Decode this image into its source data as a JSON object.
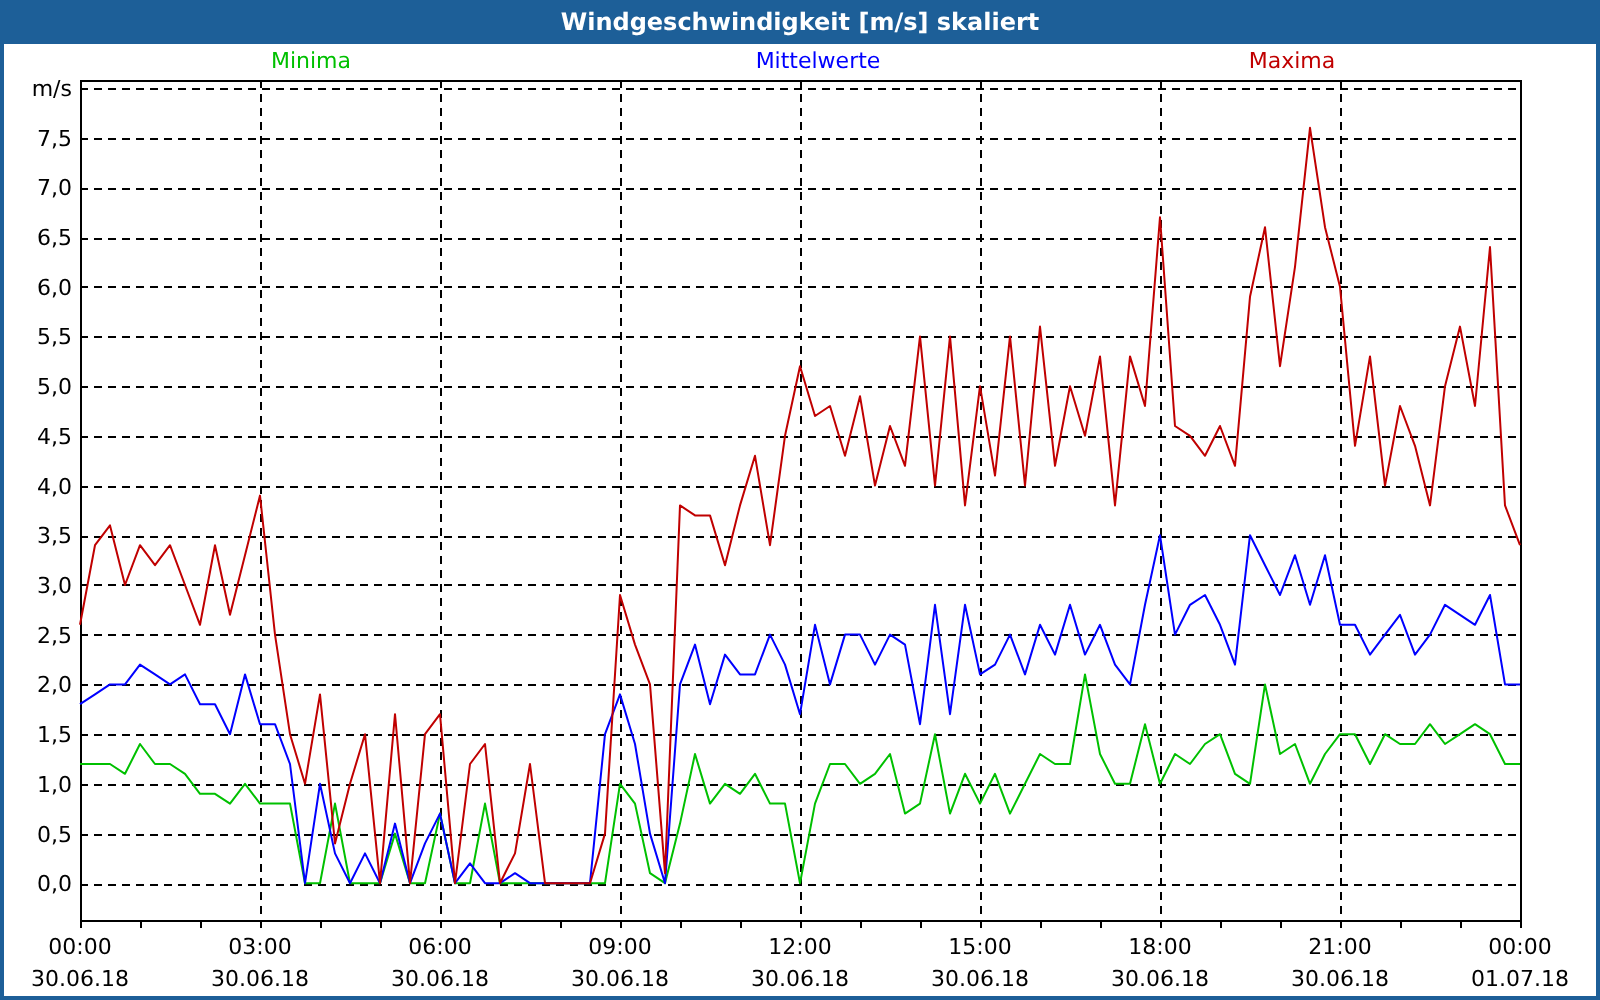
{
  "window": {
    "title": "Windgeschwindigkeit [m/s] skaliert"
  },
  "chart": {
    "chart_data": {
      "type": "line",
      "grid": true,
      "ylabel": "m/s",
      "ylim": [
        -0.37,
        8.08
      ],
      "categories": [
        "00:00\n30.06.18",
        null,
        null,
        null,
        null,
        null,
        null,
        null,
        null,
        null,
        null,
        null,
        "03:00\n30.06.18",
        null,
        null,
        null,
        null,
        null,
        null,
        null,
        null,
        null,
        null,
        null,
        "06:00\n30.06.18",
        null,
        null,
        null,
        null,
        null,
        null,
        null,
        null,
        null,
        null,
        null,
        "09:00\n30.06.18",
        null,
        null,
        null,
        null,
        null,
        null,
        null,
        null,
        null,
        null,
        null,
        "12:00\n30.06.18",
        null,
        null,
        null,
        null,
        null,
        null,
        null,
        null,
        null,
        null,
        null,
        "15:00\n30.06.18",
        null,
        null,
        null,
        null,
        null,
        null,
        null,
        null,
        null,
        null,
        null,
        "18:00\n30.06.18",
        null,
        null,
        null,
        null,
        null,
        null,
        null,
        null,
        null,
        null,
        null,
        "21:00\n30.06.18",
        null,
        null,
        null,
        null,
        null,
        null,
        null,
        null,
        null,
        null,
        null,
        "00:00\n01.07.18"
      ],
      "series": [
        {
          "name": "Minima",
          "color": "#00c000",
          "values": [
            1.2,
            1.2,
            1.2,
            1.1,
            1.4,
            1.2,
            1.2,
            1.1,
            0.9,
            0.9,
            0.8,
            1.0,
            0.8,
            0.8,
            0.8,
            0.0,
            0.0,
            0.8,
            0.0,
            0.0,
            0.0,
            0.5,
            0.0,
            0.0,
            0.7,
            0.0,
            0.0,
            0.8,
            0.0,
            0.0,
            0.0,
            0.0,
            0.0,
            0.0,
            0.0,
            0.0,
            1.0,
            0.8,
            0.1,
            0.0,
            0.6,
            1.3,
            0.8,
            1.0,
            0.9,
            1.1,
            0.8,
            0.8,
            0.0,
            0.8,
            1.2,
            1.2,
            1.0,
            1.1,
            1.3,
            0.7,
            0.8,
            1.5,
            0.7,
            1.1,
            0.8,
            1.1,
            0.7,
            1.0,
            1.3,
            1.2,
            1.2,
            2.1,
            1.3,
            1.0,
            1.0,
            1.6,
            1.0,
            1.3,
            1.2,
            1.4,
            1.5,
            1.1,
            1.0,
            2.0,
            1.3,
            1.4,
            1.0,
            1.3,
            1.5,
            1.5,
            1.2,
            1.5,
            1.4,
            1.4,
            1.6,
            1.4,
            1.5,
            1.6,
            1.5,
            1.2,
            1.2
          ]
        },
        {
          "name": "Mittelwerte",
          "color": "#0000ff",
          "values": [
            1.8,
            1.9,
            2.0,
            2.0,
            2.2,
            2.1,
            2.0,
            2.1,
            1.8,
            1.8,
            1.5,
            2.1,
            1.6,
            1.6,
            1.2,
            0.0,
            1.0,
            0.3,
            0.0,
            0.3,
            0.0,
            0.6,
            0.0,
            0.4,
            0.7,
            0.0,
            0.2,
            0.0,
            0.0,
            0.1,
            0.0,
            0.0,
            0.0,
            0.0,
            0.0,
            1.5,
            1.9,
            1.4,
            0.5,
            0.0,
            2.0,
            2.4,
            1.8,
            2.3,
            2.1,
            2.1,
            2.5,
            2.2,
            1.7,
            2.6,
            2.0,
            2.5,
            2.5,
            2.2,
            2.5,
            2.4,
            1.6,
            2.8,
            1.7,
            2.8,
            2.1,
            2.2,
            2.5,
            2.1,
            2.6,
            2.3,
            2.8,
            2.3,
            2.6,
            2.2,
            2.0,
            2.8,
            3.5,
            2.5,
            2.8,
            2.9,
            2.6,
            2.2,
            3.5,
            3.2,
            2.9,
            3.3,
            2.8,
            3.3,
            2.6,
            2.6,
            2.3,
            2.5,
            2.7,
            2.3,
            2.5,
            2.8,
            2.7,
            2.6,
            2.9,
            2.0,
            2.0
          ]
        },
        {
          "name": "Maxima",
          "color": "#c00000",
          "values": [
            2.6,
            3.4,
            3.6,
            3.0,
            3.4,
            3.2,
            3.4,
            3.0,
            2.6,
            3.4,
            2.7,
            3.3,
            3.9,
            2.5,
            1.5,
            1.0,
            1.9,
            0.4,
            1.0,
            1.5,
            0.0,
            1.7,
            0.0,
            1.5,
            1.7,
            0.0,
            1.2,
            1.4,
            0.0,
            0.3,
            1.2,
            0.0,
            0.0,
            0.0,
            0.0,
            0.5,
            2.9,
            2.4,
            2.0,
            0.1,
            3.8,
            3.7,
            3.7,
            3.2,
            3.8,
            4.3,
            3.4,
            4.5,
            5.2,
            4.7,
            4.8,
            4.3,
            4.9,
            4.0,
            4.6,
            4.2,
            5.5,
            4.0,
            5.5,
            3.8,
            5.0,
            4.1,
            5.5,
            4.0,
            5.6,
            4.2,
            5.0,
            4.5,
            5.3,
            3.8,
            5.3,
            4.8,
            6.7,
            4.6,
            4.5,
            4.3,
            4.6,
            4.2,
            5.9,
            6.6,
            5.2,
            6.2,
            7.6,
            6.6,
            6.0,
            4.4,
            5.3,
            4.0,
            4.8,
            4.4,
            3.8,
            5.0,
            5.6,
            4.8,
            6.4,
            3.8,
            3.4
          ]
        }
      ],
      "yticks": [
        {
          "value": 0,
          "label": "0,0"
        },
        {
          "value": 0.5,
          "label": "0,5"
        },
        {
          "value": 1,
          "label": "1,0"
        },
        {
          "value": 1.5,
          "label": "1,5"
        },
        {
          "value": 2,
          "label": "2,0"
        },
        {
          "value": 2.5,
          "label": "2,5"
        },
        {
          "value": 3,
          "label": "3,0"
        },
        {
          "value": 3.5,
          "label": "3,5"
        },
        {
          "value": 4,
          "label": "4,0"
        },
        {
          "value": 4.5,
          "label": "4,5"
        },
        {
          "value": 5,
          "label": "5,0"
        },
        {
          "value": 5.5,
          "label": "5,5"
        },
        {
          "value": 6,
          "label": "6,0"
        },
        {
          "value": 6.5,
          "label": "6,5"
        },
        {
          "value": 7,
          "label": "7,0"
        },
        {
          "value": 7.5,
          "label": "7,5"
        }
      ]
    }
  }
}
